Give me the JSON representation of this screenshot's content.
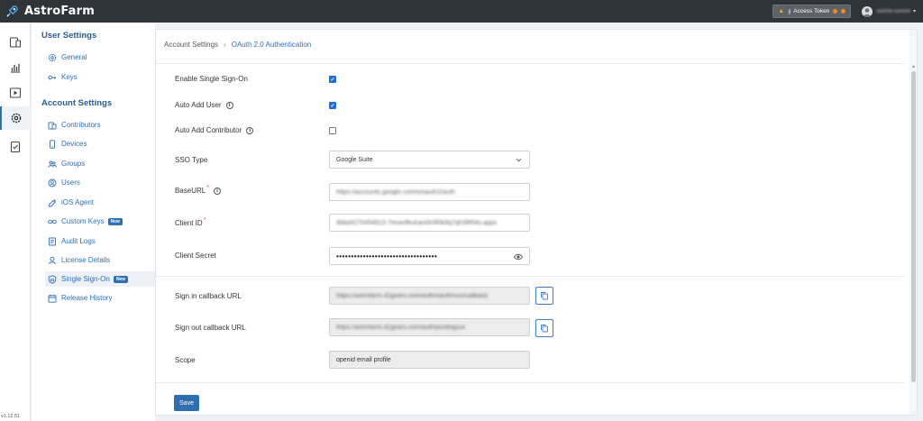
{
  "app": {
    "name": "AstroFarm",
    "version": "v1.12.51"
  },
  "topbar": {
    "access_token_label": "Access Token",
    "user_name": "rashmi.suresh"
  },
  "rail": {
    "items": [
      {
        "icon": "devices-icon"
      },
      {
        "icon": "bar-chart-icon"
      },
      {
        "icon": "play-icon"
      },
      {
        "icon": "gear-icon",
        "active": true
      },
      {
        "icon": "checklist-icon"
      }
    ]
  },
  "sidebar": {
    "user_settings_title": "User Settings",
    "user_items": [
      {
        "label": "General",
        "icon": "gear-icon"
      },
      {
        "label": "Keys",
        "icon": "key-icon"
      }
    ],
    "account_settings_title": "Account Settings",
    "account_items": [
      {
        "label": "Contributors",
        "icon": "contributors-icon"
      },
      {
        "label": "Devices",
        "icon": "device-icon"
      },
      {
        "label": "Groups",
        "icon": "groups-icon"
      },
      {
        "label": "Users",
        "icon": "user-icon"
      },
      {
        "label": "iOS Agent",
        "icon": "ios-agent-icon"
      },
      {
        "label": "Custom Keys",
        "icon": "custom-keys-icon",
        "badge": "New"
      },
      {
        "label": "Audit Logs",
        "icon": "audit-logs-icon"
      },
      {
        "label": "License Details",
        "icon": "license-icon"
      },
      {
        "label": "Single Sign-On",
        "icon": "shield-icon",
        "badge": "New",
        "active": true
      },
      {
        "label": "Release History",
        "icon": "calendar-icon"
      }
    ]
  },
  "breadcrumb": {
    "parent": "Account Settings",
    "separator": "›",
    "current": "OAuth 2.0 Authentication"
  },
  "form": {
    "enable_sso": {
      "label": "Enable Single Sign-On",
      "checked": true
    },
    "auto_add_user": {
      "label": "Auto Add User",
      "checked": true
    },
    "auto_add_contributor": {
      "label": "Auto Add Contributor",
      "checked": false
    },
    "sso_type": {
      "label": "SSO Type",
      "value": "Google Suite"
    },
    "base_url": {
      "label": "BaseURL",
      "value": "https://accounts.google.com/o/oauth2/auth"
    },
    "client_id": {
      "label": "Client ID",
      "value": "4bbd4270454913-7reuiv9kuhanl3r3f0b3q7qh39f54u.apps"
    },
    "client_secret": {
      "label": "Client Secret",
      "value": "••••••••••••••••••••••••••••••••••"
    },
    "sign_in_callback": {
      "label": "Sign in callback URL",
      "value": "https://astrofarm.42gears.com/auth/oauth/sso/callback"
    },
    "sign_out_callback": {
      "label": "Sign out callback URL",
      "value": "https://astrofarm.42gears.com/auth/postlogout"
    },
    "scope": {
      "label": "Scope",
      "value": "openid email profile"
    },
    "save_label": "Save"
  },
  "colors": {
    "accent": "#2f6fb0",
    "topbar": "#2f3439",
    "checkbox": "#1f6fd1"
  }
}
